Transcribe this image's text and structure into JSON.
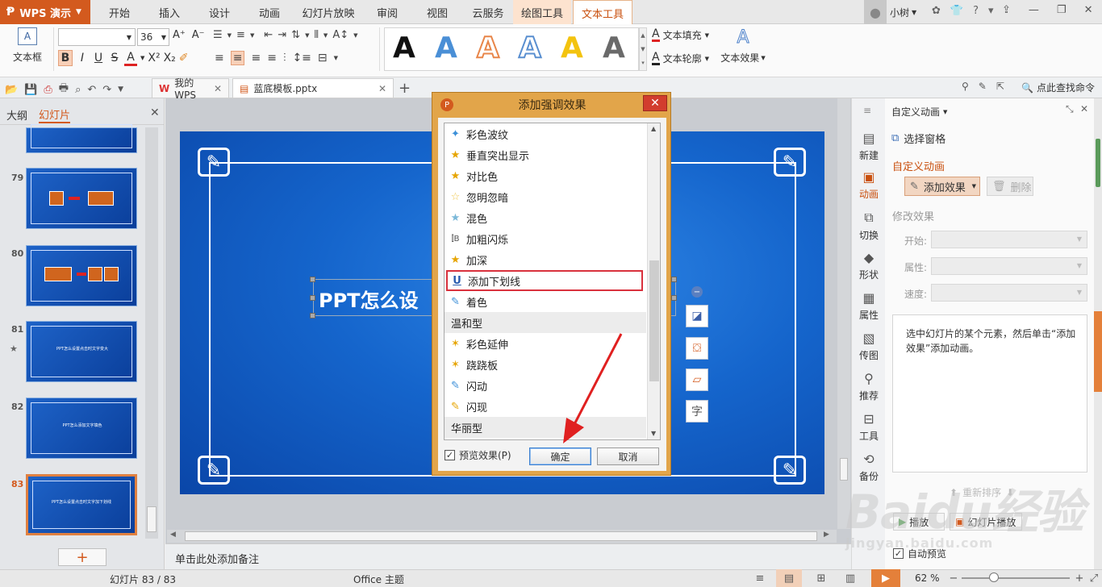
{
  "app": {
    "title": "WPS 演示"
  },
  "menu": {
    "items": [
      "开始",
      "插入",
      "设计",
      "动画",
      "幻灯片放映",
      "审阅",
      "视图",
      "云服务",
      "绘图工具",
      "文本工具"
    ]
  },
  "user": {
    "name": "小树"
  },
  "ribbon": {
    "textbox_label": "文本框",
    "font_size": "36",
    "text_fill": "文本填充",
    "text_outline": "文本轮廓",
    "text_effect": "文本效果",
    "style_letter": "A"
  },
  "doc_tabs": {
    "my_wps": "我的WPS",
    "file": "蓝底模板.pptx",
    "search": "点此查找命令"
  },
  "leftpanel": {
    "tabs": [
      "大纲",
      "幻灯片"
    ],
    "slides": [
      {
        "num": "79",
        "text": ""
      },
      {
        "num": "80",
        "text": ""
      },
      {
        "num": "81",
        "text": "PPT怎么设置点击时文字变大"
      },
      {
        "num": "82",
        "text": "PPT怎么添加文字填色"
      },
      {
        "num": "83",
        "text": "PPT怎么设置点击时文字加下划线"
      }
    ]
  },
  "slide": {
    "title_text": "PPT怎么设"
  },
  "notes": {
    "placeholder": "单击此处添加备注"
  },
  "dialog": {
    "title": "添加强调效果",
    "items": [
      {
        "label": "彩色波纹",
        "type": "item"
      },
      {
        "label": "垂直突出显示",
        "type": "item"
      },
      {
        "label": "对比色",
        "type": "item"
      },
      {
        "label": "忽明忽暗",
        "type": "item"
      },
      {
        "label": "混色",
        "type": "item"
      },
      {
        "label": "加粗闪烁",
        "type": "item"
      },
      {
        "label": "加深",
        "type": "item"
      },
      {
        "label": "添加下划线",
        "type": "selected"
      },
      {
        "label": "着色",
        "type": "item"
      },
      {
        "label": "温和型",
        "type": "group"
      },
      {
        "label": "彩色延伸",
        "type": "item"
      },
      {
        "label": "跷跷板",
        "type": "item"
      },
      {
        "label": "闪动",
        "type": "item"
      },
      {
        "label": "闪现",
        "type": "item"
      },
      {
        "label": "华丽型",
        "type": "group"
      }
    ],
    "preview_label": "预览效果(P)",
    "ok": "确定",
    "cancel": "取消"
  },
  "sidebar": {
    "items": [
      "新建",
      "动画",
      "切换",
      "形状",
      "属性",
      "传图",
      "推荐",
      "工具",
      "备份"
    ]
  },
  "taskpane": {
    "header": "自定义动画",
    "select_pane": "选择窗格",
    "section_title": "自定义动画",
    "add_effect": "添加效果",
    "delete": "删除",
    "modify_title": "修改效果",
    "start_label": "开始:",
    "property_label": "属性:",
    "speed_label": "速度:",
    "hint": "选中幻灯片的某个元素，然后单击“添加效果”添加动画。",
    "reorder": "重新排序",
    "play": "播放",
    "slideshow": "幻灯片播放",
    "autopreview": "自动预览"
  },
  "status": {
    "slide_info": "幻灯片 83 / 83",
    "theme": "Office 主题",
    "zoom": "62 %"
  },
  "watermark": {
    "text": "Baidu经验",
    "sub": "jingyan.baidu.com"
  }
}
